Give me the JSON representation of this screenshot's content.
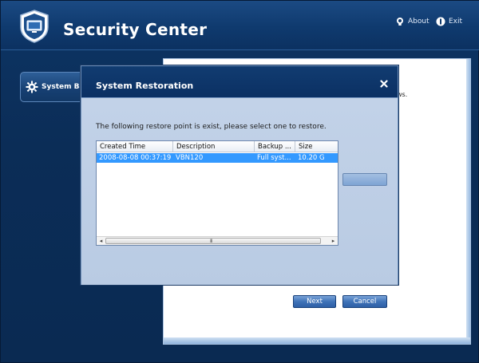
{
  "app": {
    "title": "Security Center",
    "about_label": "About",
    "exit_label": "Exit"
  },
  "sidebar": {
    "items": [
      {
        "label": "System Bac",
        "icon": "gear-icon"
      }
    ]
  },
  "content": {
    "fragment_text": "ws."
  },
  "dialog": {
    "title": "System Restoration",
    "instruction": "The following restore point is exist, please select one to restore.",
    "columns": [
      "Created Time",
      "Description",
      "Backup ...",
      "Size"
    ],
    "rows": [
      {
        "created_time": "2008-08-08 00:37:19",
        "description": "VBN120",
        "backup": "Full syst...",
        "size": "10.20 G",
        "selected": true
      }
    ],
    "scroll_grip": "III",
    "next_label": "Next",
    "cancel_label": "Cancel",
    "side_button_label": ""
  },
  "colors": {
    "selection": "#3399ff",
    "header_bg": "#0f3a6e",
    "button": "#3f73b8"
  }
}
